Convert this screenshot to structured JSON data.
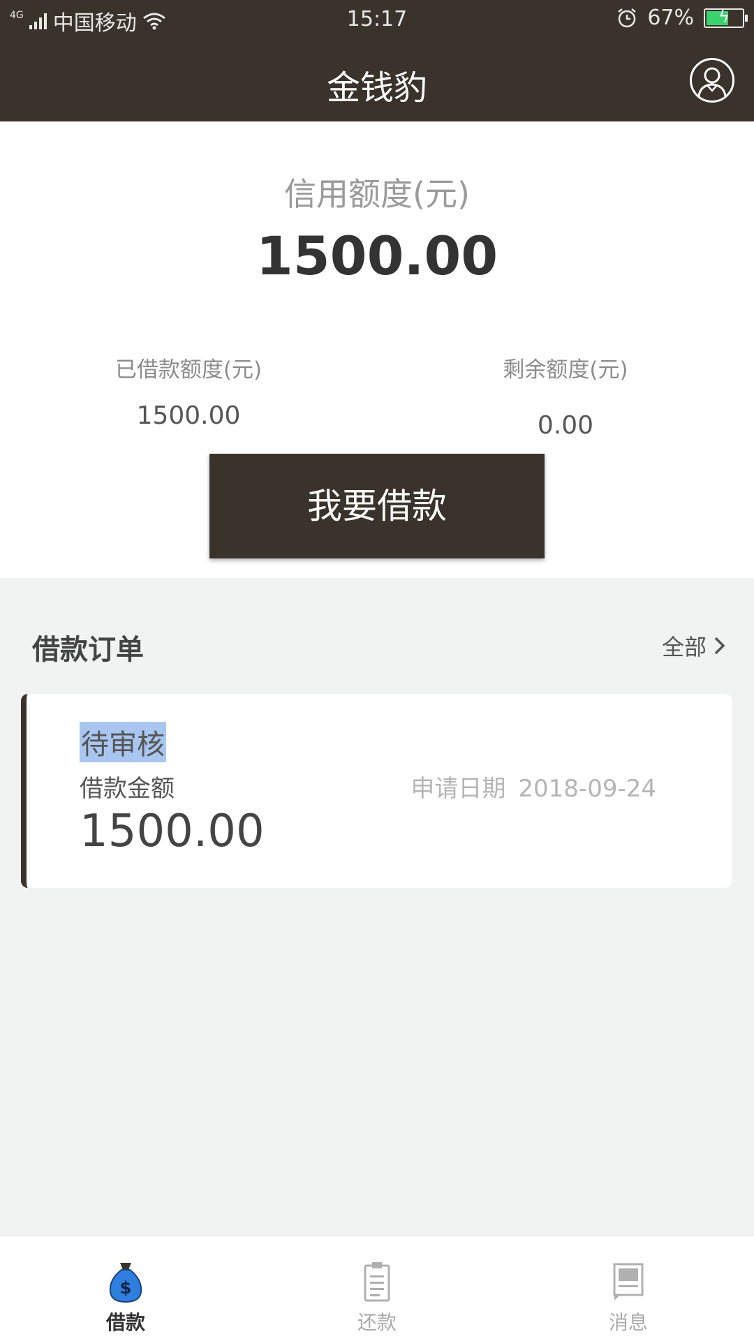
{
  "status_bar": {
    "network": "4G",
    "carrier": "中国移动",
    "time": "15:17",
    "battery": "67%",
    "battery_level": 0.67
  },
  "nav": {
    "title": "金钱豹",
    "profile_icon": "user-avatar-icon"
  },
  "credit": {
    "label": "信用额度(元)",
    "value": "1500.00",
    "used_label": "已借款额度(元)",
    "used_value": "1500.00",
    "remaining_label": "剩余额度(元)",
    "remaining_value": "0.00",
    "borrow_button": "我要借款"
  },
  "orders": {
    "title": "借款订单",
    "all_label": "全部",
    "items": [
      {
        "status": "待审核",
        "amount_label": "借款金额",
        "amount": "1500.00",
        "date_label": "申请日期",
        "date": "2018-09-24"
      }
    ]
  },
  "tabbar": {
    "tabs": [
      {
        "label": "借款",
        "icon": "money-bag-icon",
        "active": true
      },
      {
        "label": "还款",
        "icon": "clipboard-icon",
        "active": false
      },
      {
        "label": "消息",
        "icon": "message-icon",
        "active": false
      }
    ]
  },
  "colors": {
    "header_bg": "#3a332b",
    "active_tab_icon": "#2f7fe0",
    "battery_fill": "#3bd16f",
    "selection_highlight": "#a9c6f0"
  }
}
